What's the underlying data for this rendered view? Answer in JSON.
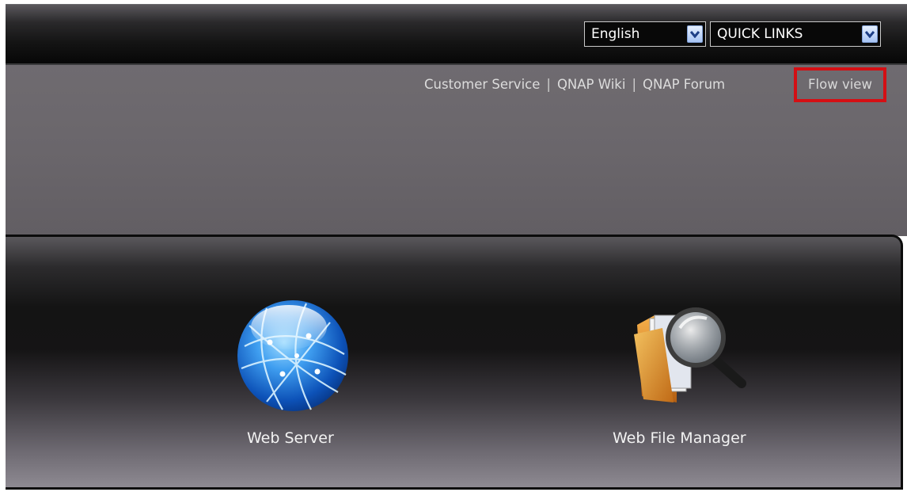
{
  "header": {
    "language_select": {
      "value": "English"
    },
    "quick_links_select": {
      "value": "QUICK LINKS"
    }
  },
  "top_links": {
    "items": [
      "Customer Service",
      "QNAP Wiki",
      "QNAP Forum"
    ],
    "separator": "|",
    "flow_view": "Flow view"
  },
  "apps": [
    {
      "label": "Web Server",
      "icon": "globe-icon"
    },
    {
      "label": "Web File Manager",
      "icon": "folder-magnifier-icon"
    }
  ],
  "colors": {
    "highlight_border": "#d40f14",
    "dropdown_arrow": "#a7c4f4"
  }
}
